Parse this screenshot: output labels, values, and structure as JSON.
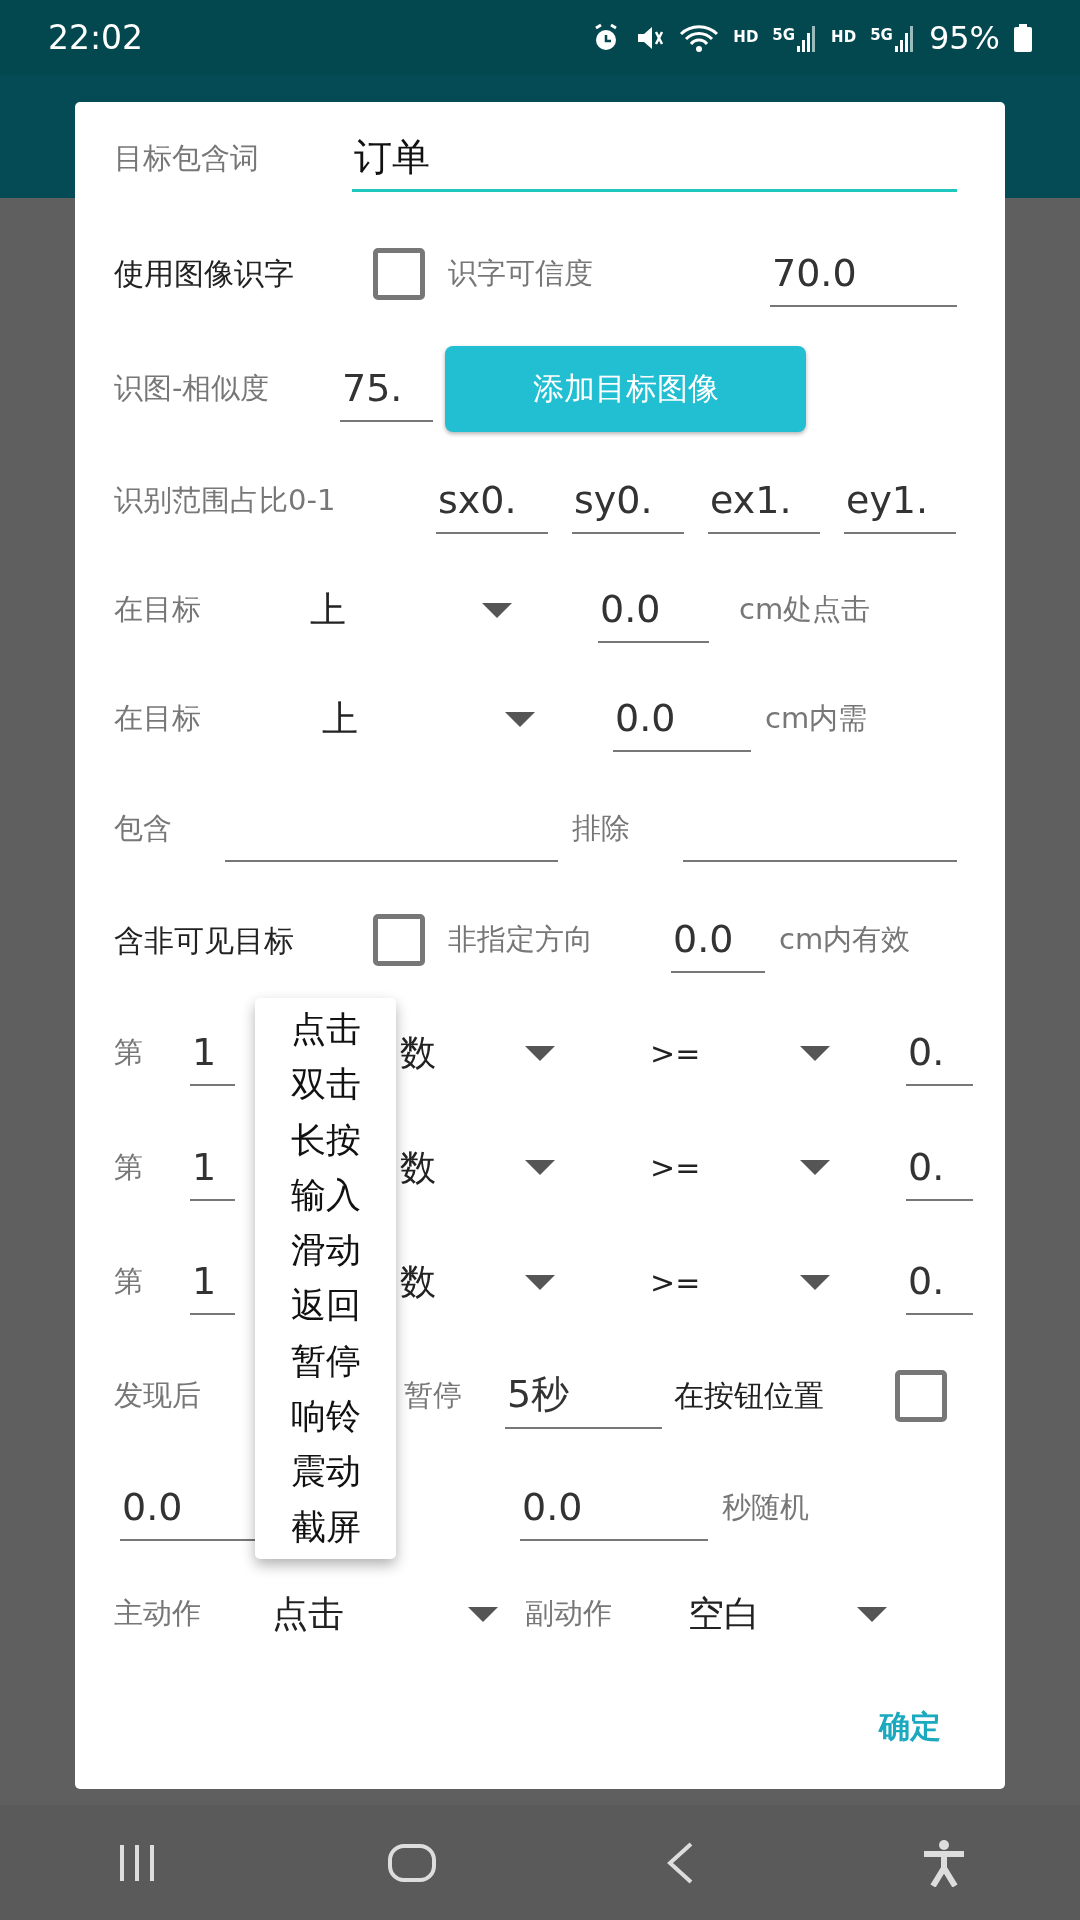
{
  "status_bar": {
    "time": "22:02",
    "indicators": [
      {
        "kind": "alarm"
      },
      {
        "kind": "mute"
      },
      {
        "kind": "wifi"
      },
      {
        "kind": "tag",
        "text": "HD"
      },
      {
        "kind": "signal",
        "text": "5G"
      },
      {
        "kind": "tag",
        "text": "HD"
      },
      {
        "kind": "signal",
        "text": "5G"
      }
    ],
    "battery": "95%"
  },
  "dialog": {
    "keyword": {
      "label": "目标包含词",
      "value": "订单"
    },
    "ocr": {
      "label": "使用图像识字",
      "checked": false,
      "confidence_label": "识字可信度",
      "confidence": "70.0"
    },
    "image": {
      "label": "识图-相似度",
      "similarity": "75.",
      "button": "添加目标图像"
    },
    "range": {
      "label": "识别范围占比0-1",
      "fields": [
        "sx0.",
        "sy0.",
        "ex1.",
        "ey1."
      ]
    },
    "click_offset": {
      "label": "在目标",
      "direction": "上",
      "distance": "0.0",
      "unit": "cm处点击"
    },
    "require_offset": {
      "label": "在目标",
      "direction": "上",
      "distance": "0.0",
      "unit": "cm内需"
    },
    "filter": {
      "include_label": "包含",
      "exclude_label": "排除"
    },
    "invisible": {
      "label": "含非可见目标",
      "checked": false,
      "direction_label": "非指定方向",
      "distance": "0.0",
      "unit": "cm内有效"
    },
    "conditions": [
      {
        "label": "第",
        "index": "1",
        "metric": "数",
        "operator": ">=",
        "value": "0."
      },
      {
        "label": "第",
        "index": "1",
        "metric": "数",
        "operator": ">=",
        "value": "0."
      },
      {
        "label": "第",
        "index": "1",
        "metric": "数",
        "operator": ">=",
        "value": "0."
      }
    ],
    "pause": {
      "label": "发现后",
      "label_2": "暂停",
      "value": "5秒",
      "position_label": "在按钮位置",
      "checked": false
    },
    "random": {
      "min": "0.0",
      "max": "0.0",
      "unit": "秒随机"
    },
    "actions": {
      "main_label": "主动作",
      "main": "点击",
      "secondary_label": "副动作",
      "secondary": "空白"
    },
    "ok": "确定"
  },
  "action_menu": {
    "items": [
      "点击",
      "双击",
      "长按",
      "输入",
      "滑动",
      "返回",
      "暂停",
      "响铃",
      "震动",
      "截屏"
    ]
  }
}
